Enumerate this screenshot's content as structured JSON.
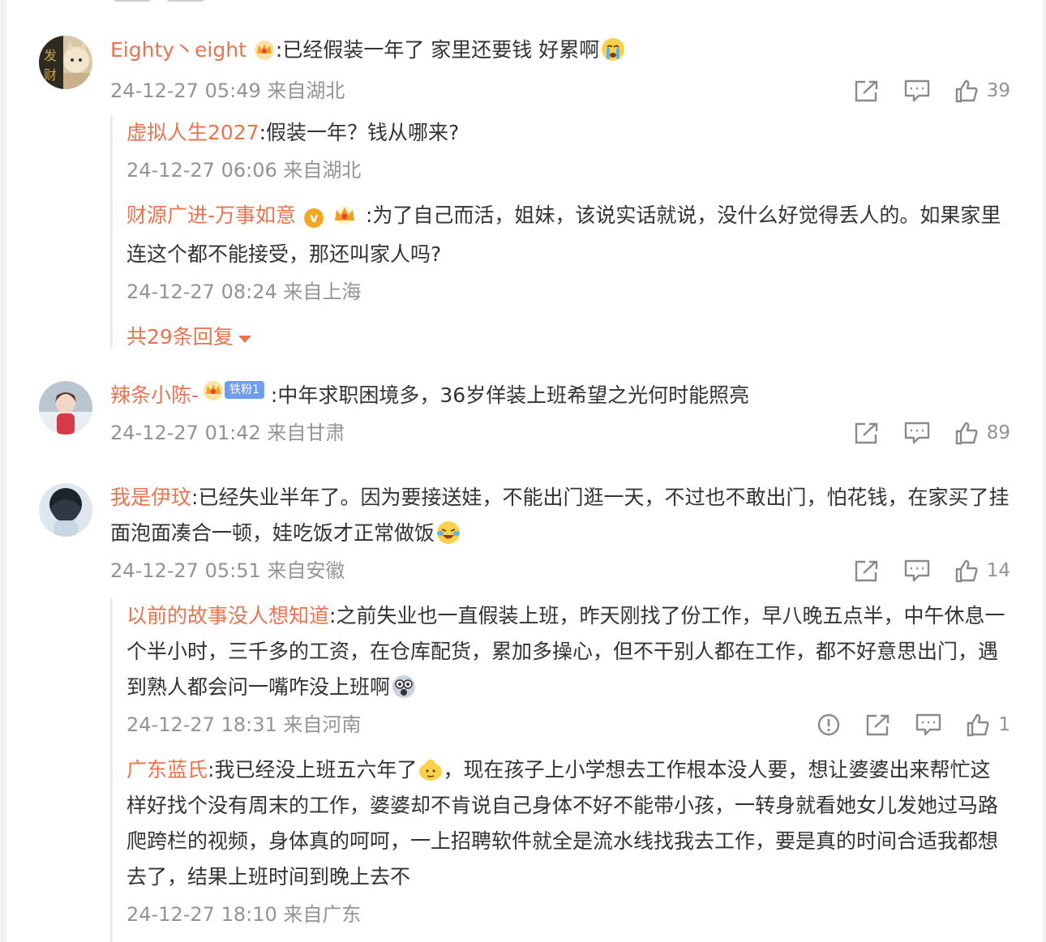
{
  "comments": [
    {
      "user": "Eighty丶eight",
      "text": ":已经假装一年了  家里还要钱  好累啊",
      "time": "24-12-27 05:49 来自湖北",
      "likes": "39",
      "replies": [
        {
          "user": "虚拟人生2027",
          "text": ":假装一年？钱从哪来?",
          "time": "24-12-27 06:06 来自湖北"
        },
        {
          "user": "财源广进-万事如意",
          "text": " :为了自己而活，姐妹，该说实话就说，没什么好觉得丢人的。如果家里连这个都不能接受，那还叫家人吗?",
          "time": "24-12-27 08:24 来自上海"
        }
      ],
      "more_replies": "共29条回复"
    },
    {
      "user": "辣条小陈-",
      "fan_badge": "铁粉1",
      "text": " :中年求职困境多，36岁佯装上班希望之光何时能照亮",
      "time": "24-12-27 01:42 来自甘肃",
      "likes": "89"
    },
    {
      "user": "我是伊玟",
      "text": ":已经失业半年了。因为要接送娃，不能出门逛一天，不过也不敢出门，怕花钱，在家买了挂面泡面凑合一顿，娃吃饭才正常做饭",
      "time": "24-12-27 05:51 来自安徽",
      "likes": "14",
      "replies": [
        {
          "user": "以前的故事没人想知道",
          "text": ":之前失业也一直假装上班，昨天刚找了份工作，早八晚五点半，中午休息一个半小时，三千多的工资，在仓库配货，累加多操心，但不干别人都在工作，都不好意思出门，遇到熟人都会问一嘴咋没上班啊",
          "time": "24-12-27 18:31 来自河南",
          "likes": "1"
        },
        {
          "user": "广东蓝氏",
          "text": ":我已经没上班五六年了",
          "text2": "，现在孩子上小学想去工作根本没人要，想让婆婆出来帮忙这样好找个没有周末的工作，婆婆却不肯说自己身体不好不能带小孩，一转身就看她女儿发她过马路爬跨栏的视频，身体真的呵呵，一上招聘软件就全是流水线找我去工作，要是真的时间合适我都想去了，结果上班时间到晚上去不",
          "time": "24-12-27 18:10 来自广东"
        }
      ]
    }
  ],
  "colors": {
    "name": "#eb7350",
    "meta": "#939393",
    "text": "#333333"
  },
  "icons": [
    "share-icon",
    "comment-icon",
    "like-icon",
    "report-icon",
    "crown-icon",
    "verified-icon",
    "emoji-icon"
  ]
}
